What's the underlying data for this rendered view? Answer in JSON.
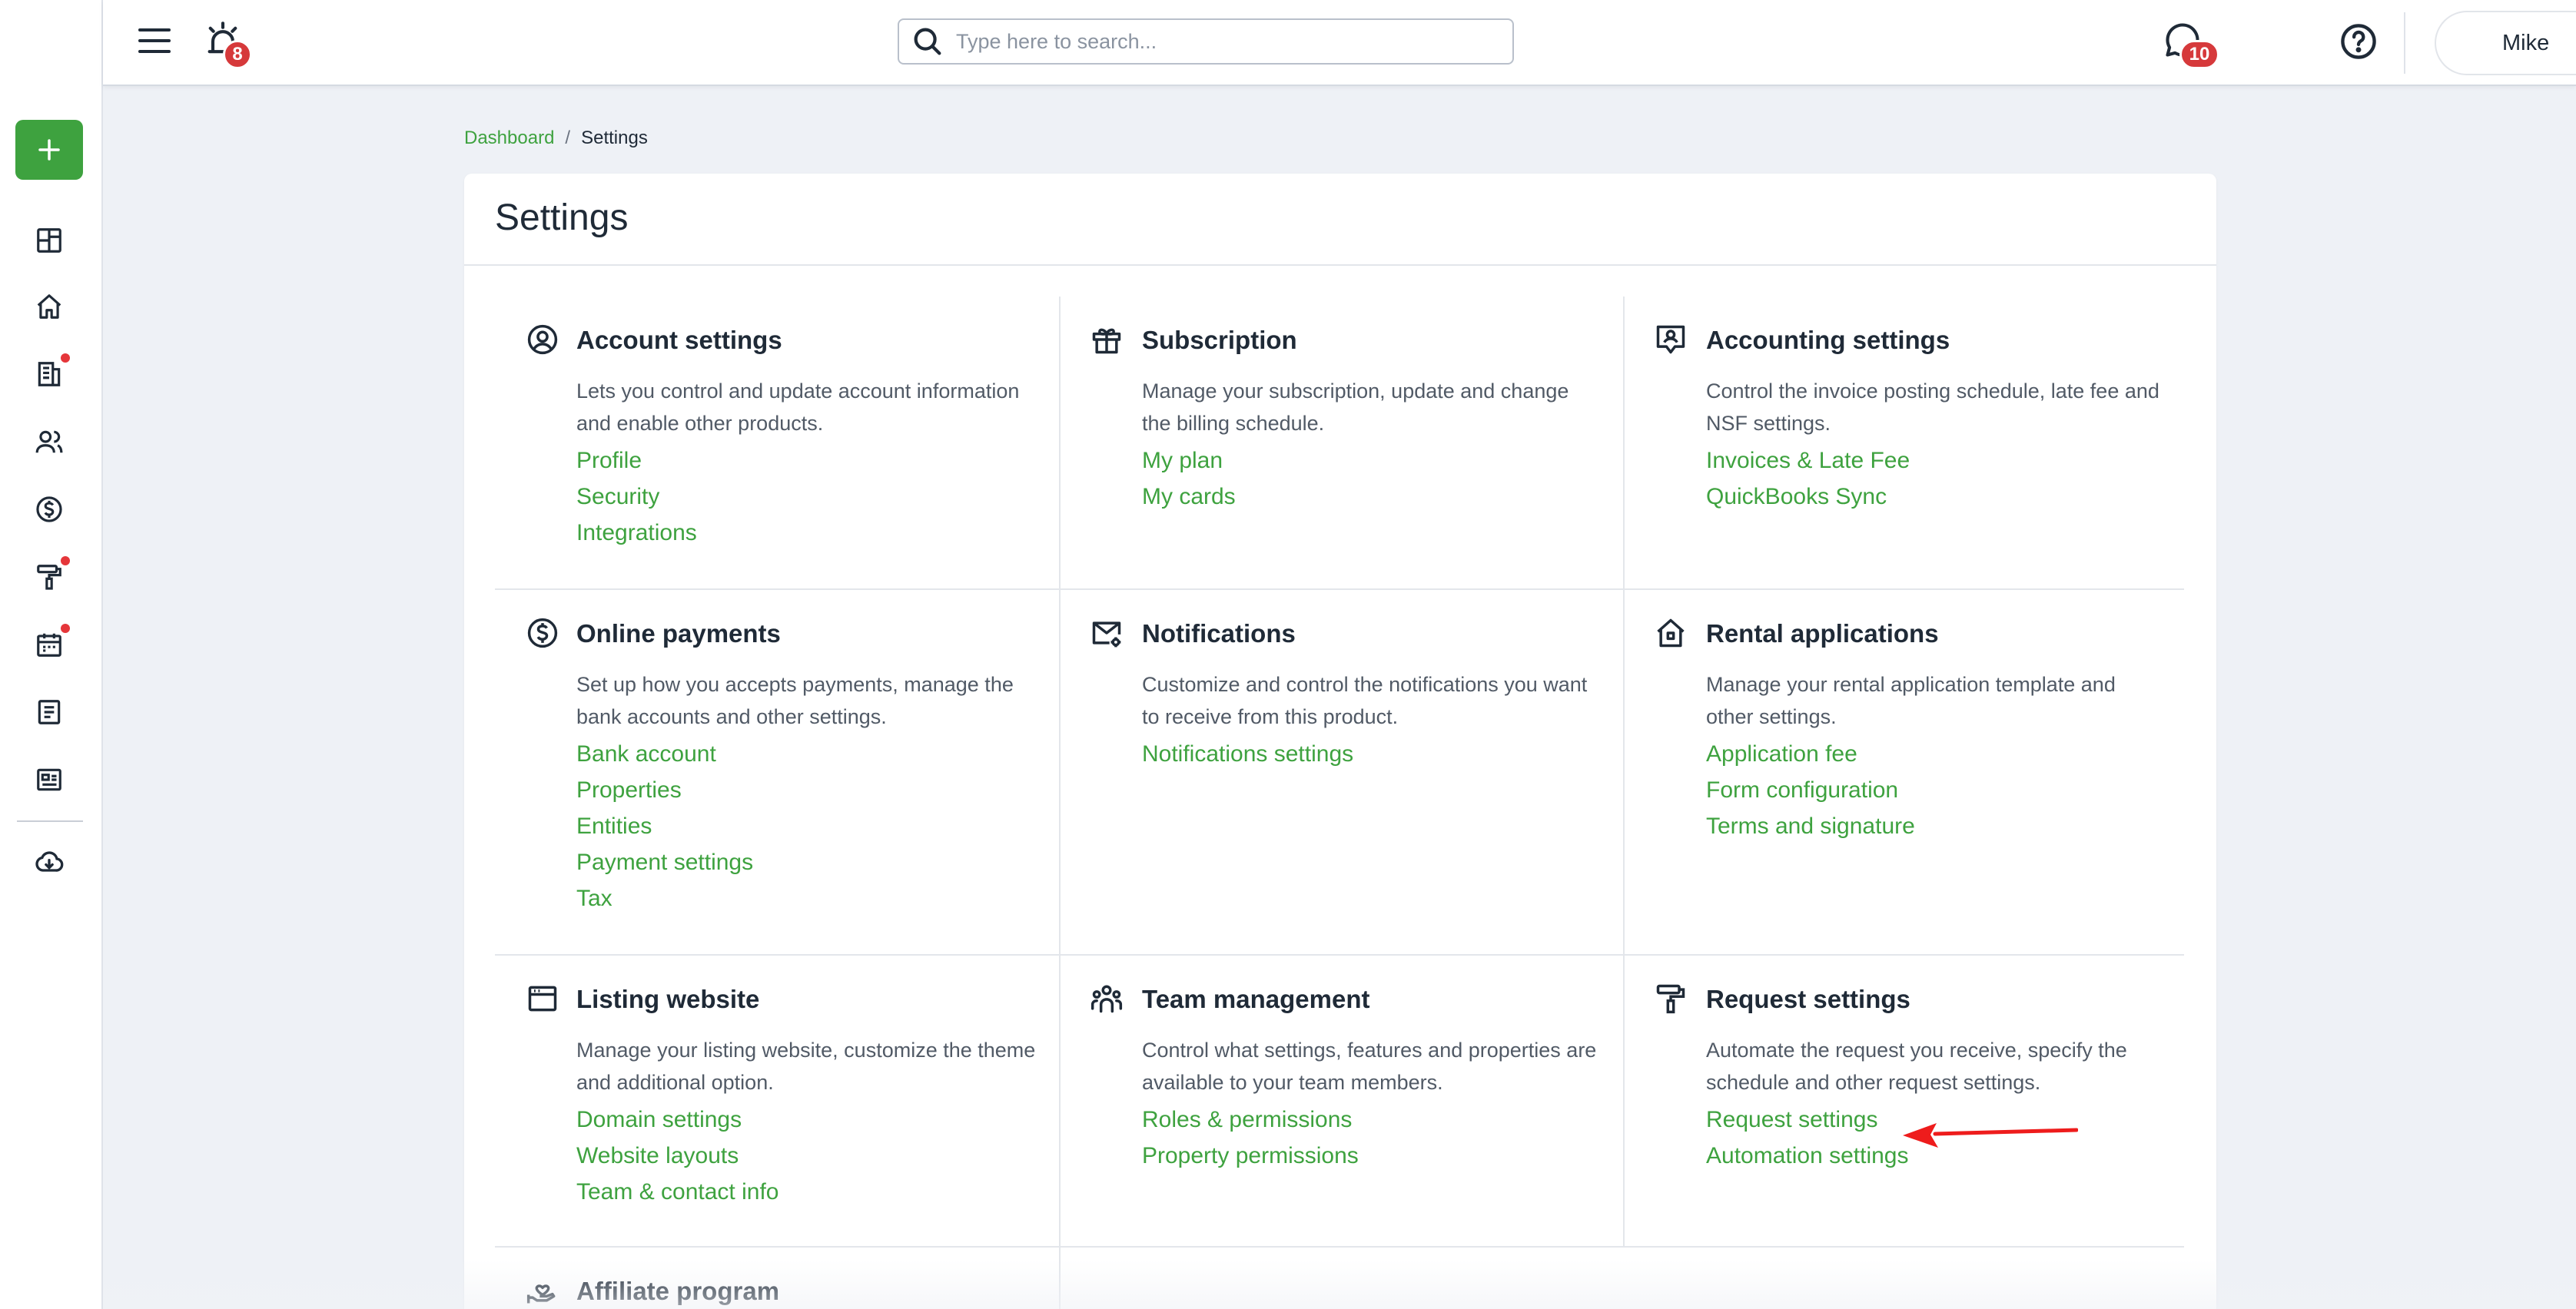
{
  "topbar": {
    "alarm_count": "8",
    "search_placeholder": "Type here to search...",
    "chat_count": "10",
    "user_name": "Mike"
  },
  "sidebar": {
    "items": [
      {
        "icon": "dashboard-icon"
      },
      {
        "icon": "home-icon"
      },
      {
        "icon": "leases-icon",
        "dot": true
      },
      {
        "icon": "people-icon"
      },
      {
        "icon": "dollar-icon"
      },
      {
        "icon": "paint-roller-icon",
        "dot": true
      },
      {
        "icon": "calendar-icon",
        "dot": true
      },
      {
        "icon": "document-icon"
      },
      {
        "icon": "listing-icon"
      },
      {
        "icon": "cloud-download-icon"
      }
    ]
  },
  "breadcrumb": {
    "link": "Dashboard",
    "separator": "/",
    "current": "Settings"
  },
  "page_title": "Settings",
  "sections": [
    {
      "title": "Account settings",
      "icon": "user-circle-icon",
      "description": "Lets you control and update account information and enable other products.",
      "links": [
        "Profile",
        "Security",
        "Integrations"
      ]
    },
    {
      "title": "Subscription",
      "icon": "gift-icon",
      "description": "Manage your subscription, update and change the billing schedule.",
      "links": [
        "My plan",
        "My cards"
      ]
    },
    {
      "title": "Accounting settings",
      "icon": "accounting-icon",
      "description": "Control the invoice posting schedule, late fee and NSF settings.",
      "links": [
        "Invoices & Late Fee",
        "QuickBooks Sync"
      ]
    },
    {
      "title": "Online payments",
      "icon": "dollar-circle-icon",
      "description": "Set up how you accepts payments, manage the bank accounts and other settings.",
      "links": [
        "Bank account",
        "Properties",
        "Entities",
        "Payment settings",
        "Tax"
      ]
    },
    {
      "title": "Notifications",
      "icon": "mail-gear-icon",
      "description": "Customize and control the notifications you want to receive from this product.",
      "links": [
        "Notifications settings"
      ]
    },
    {
      "title": "Rental applications",
      "icon": "house-icon",
      "description": "Manage your rental application template and other settings.",
      "links": [
        "Application fee",
        "Form configuration",
        "Terms and signature"
      ]
    },
    {
      "title": "Listing website",
      "icon": "browser-window-icon",
      "description": "Manage your listing website, customize the theme and additional option.",
      "links": [
        "Domain settings",
        "Website layouts",
        "Team & contact info"
      ]
    },
    {
      "title": "Team management",
      "icon": "team-icon",
      "description": "Control what settings, features and properties are available to your team members.",
      "links": [
        "Roles & permissions",
        "Property permissions"
      ]
    },
    {
      "title": "Request settings",
      "icon": "paint-roller-icon",
      "description": "Automate the request you receive, specify the schedule and other request settings.",
      "links": [
        "Request settings",
        "Automation settings"
      ]
    },
    {
      "title": "Affiliate program",
      "icon": "hand-heart-icon",
      "description": "",
      "links": []
    }
  ],
  "colors": {
    "accent": "#3ea23f",
    "badge": "#d6393b",
    "annotation_arrow": "#ee1c1c"
  }
}
